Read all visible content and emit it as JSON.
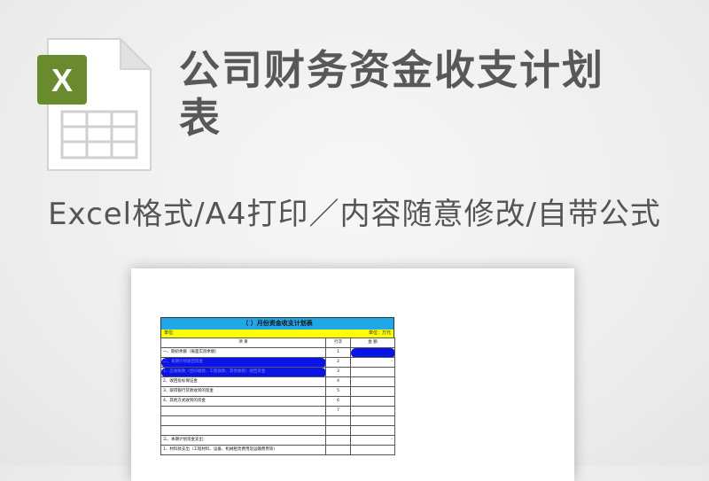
{
  "header": {
    "title": "公司财务资金收支计划表",
    "subtitle": "Excel格式/A4打印／内容随意修改/自带公式"
  },
  "icon": {
    "name": "excel-file-icon",
    "letter": "X",
    "accent": "#6a8a2e"
  },
  "sheet": {
    "title": "（  ）月份资金收支计划表",
    "unit_left": "单位:",
    "unit_right": "单位：万元",
    "col_item": "项        目",
    "col_seq": "行次",
    "col_amount": "金  额",
    "rows": [
      {
        "item": "一、期初余额（账面实际余额）",
        "seq": "1",
        "amount": ""
      },
      {
        "item": "二、本期计划收回资金",
        "seq": "2",
        "amount": "-"
      },
      {
        "item": "  1、应收账款（合同收款、工程收款、其他收款）收回资金",
        "seq": "3",
        "amount": ""
      },
      {
        "item": "  2、收回投标保证金",
        "seq": "4",
        "amount": ""
      },
      {
        "item": "  3、取得银行贷款收到的现金",
        "seq": "5",
        "amount": ""
      },
      {
        "item": "  4、其他方式收到的资金",
        "seq": "6",
        "amount": ""
      },
      {
        "item": "",
        "seq": "7",
        "amount": ""
      },
      {
        "item": "",
        "seq": "",
        "amount": ""
      },
      {
        "item": "",
        "seq": "",
        "amount": ""
      },
      {
        "item": "三、本期计划资金支出：",
        "seq": "",
        "amount": "-"
      },
      {
        "item": "  1、材料款支出（工程材料、设备、机械租赁费用及运输费用等）",
        "seq": "",
        "amount": ""
      }
    ]
  },
  "colors": {
    "title_bar": "#1fa8e8",
    "unit_bar": "#ffff00",
    "highlight": "#0a14e6"
  }
}
